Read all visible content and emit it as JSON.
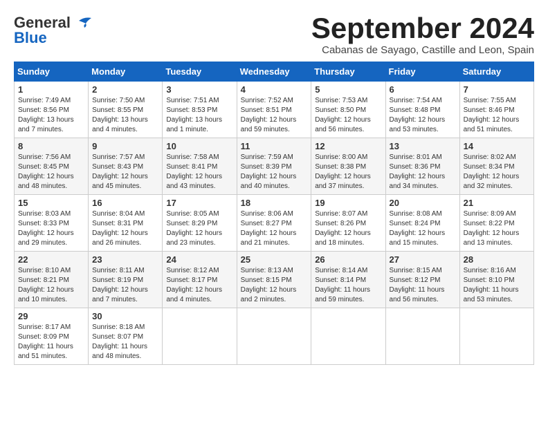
{
  "logo": {
    "text1": "General",
    "text2": "Blue"
  },
  "title": "September 2024",
  "subtitle": "Cabanas de Sayago, Castille and Leon, Spain",
  "headers": [
    "Sunday",
    "Monday",
    "Tuesday",
    "Wednesday",
    "Thursday",
    "Friday",
    "Saturday"
  ],
  "weeks": [
    [
      {
        "day": "1",
        "info": "Sunrise: 7:49 AM\nSunset: 8:56 PM\nDaylight: 13 hours and 7 minutes."
      },
      {
        "day": "2",
        "info": "Sunrise: 7:50 AM\nSunset: 8:55 PM\nDaylight: 13 hours and 4 minutes."
      },
      {
        "day": "3",
        "info": "Sunrise: 7:51 AM\nSunset: 8:53 PM\nDaylight: 13 hours and 1 minute."
      },
      {
        "day": "4",
        "info": "Sunrise: 7:52 AM\nSunset: 8:51 PM\nDaylight: 12 hours and 59 minutes."
      },
      {
        "day": "5",
        "info": "Sunrise: 7:53 AM\nSunset: 8:50 PM\nDaylight: 12 hours and 56 minutes."
      },
      {
        "day": "6",
        "info": "Sunrise: 7:54 AM\nSunset: 8:48 PM\nDaylight: 12 hours and 53 minutes."
      },
      {
        "day": "7",
        "info": "Sunrise: 7:55 AM\nSunset: 8:46 PM\nDaylight: 12 hours and 51 minutes."
      }
    ],
    [
      {
        "day": "8",
        "info": "Sunrise: 7:56 AM\nSunset: 8:45 PM\nDaylight: 12 hours and 48 minutes."
      },
      {
        "day": "9",
        "info": "Sunrise: 7:57 AM\nSunset: 8:43 PM\nDaylight: 12 hours and 45 minutes."
      },
      {
        "day": "10",
        "info": "Sunrise: 7:58 AM\nSunset: 8:41 PM\nDaylight: 12 hours and 43 minutes."
      },
      {
        "day": "11",
        "info": "Sunrise: 7:59 AM\nSunset: 8:39 PM\nDaylight: 12 hours and 40 minutes."
      },
      {
        "day": "12",
        "info": "Sunrise: 8:00 AM\nSunset: 8:38 PM\nDaylight: 12 hours and 37 minutes."
      },
      {
        "day": "13",
        "info": "Sunrise: 8:01 AM\nSunset: 8:36 PM\nDaylight: 12 hours and 34 minutes."
      },
      {
        "day": "14",
        "info": "Sunrise: 8:02 AM\nSunset: 8:34 PM\nDaylight: 12 hours and 32 minutes."
      }
    ],
    [
      {
        "day": "15",
        "info": "Sunrise: 8:03 AM\nSunset: 8:33 PM\nDaylight: 12 hours and 29 minutes."
      },
      {
        "day": "16",
        "info": "Sunrise: 8:04 AM\nSunset: 8:31 PM\nDaylight: 12 hours and 26 minutes."
      },
      {
        "day": "17",
        "info": "Sunrise: 8:05 AM\nSunset: 8:29 PM\nDaylight: 12 hours and 23 minutes."
      },
      {
        "day": "18",
        "info": "Sunrise: 8:06 AM\nSunset: 8:27 PM\nDaylight: 12 hours and 21 minutes."
      },
      {
        "day": "19",
        "info": "Sunrise: 8:07 AM\nSunset: 8:26 PM\nDaylight: 12 hours and 18 minutes."
      },
      {
        "day": "20",
        "info": "Sunrise: 8:08 AM\nSunset: 8:24 PM\nDaylight: 12 hours and 15 minutes."
      },
      {
        "day": "21",
        "info": "Sunrise: 8:09 AM\nSunset: 8:22 PM\nDaylight: 12 hours and 13 minutes."
      }
    ],
    [
      {
        "day": "22",
        "info": "Sunrise: 8:10 AM\nSunset: 8:21 PM\nDaylight: 12 hours and 10 minutes."
      },
      {
        "day": "23",
        "info": "Sunrise: 8:11 AM\nSunset: 8:19 PM\nDaylight: 12 hours and 7 minutes."
      },
      {
        "day": "24",
        "info": "Sunrise: 8:12 AM\nSunset: 8:17 PM\nDaylight: 12 hours and 4 minutes."
      },
      {
        "day": "25",
        "info": "Sunrise: 8:13 AM\nSunset: 8:15 PM\nDaylight: 12 hours and 2 minutes."
      },
      {
        "day": "26",
        "info": "Sunrise: 8:14 AM\nSunset: 8:14 PM\nDaylight: 11 hours and 59 minutes."
      },
      {
        "day": "27",
        "info": "Sunrise: 8:15 AM\nSunset: 8:12 PM\nDaylight: 11 hours and 56 minutes."
      },
      {
        "day": "28",
        "info": "Sunrise: 8:16 AM\nSunset: 8:10 PM\nDaylight: 11 hours and 53 minutes."
      }
    ],
    [
      {
        "day": "29",
        "info": "Sunrise: 8:17 AM\nSunset: 8:09 PM\nDaylight: 11 hours and 51 minutes."
      },
      {
        "day": "30",
        "info": "Sunrise: 8:18 AM\nSunset: 8:07 PM\nDaylight: 11 hours and 48 minutes."
      },
      null,
      null,
      null,
      null,
      null
    ]
  ]
}
